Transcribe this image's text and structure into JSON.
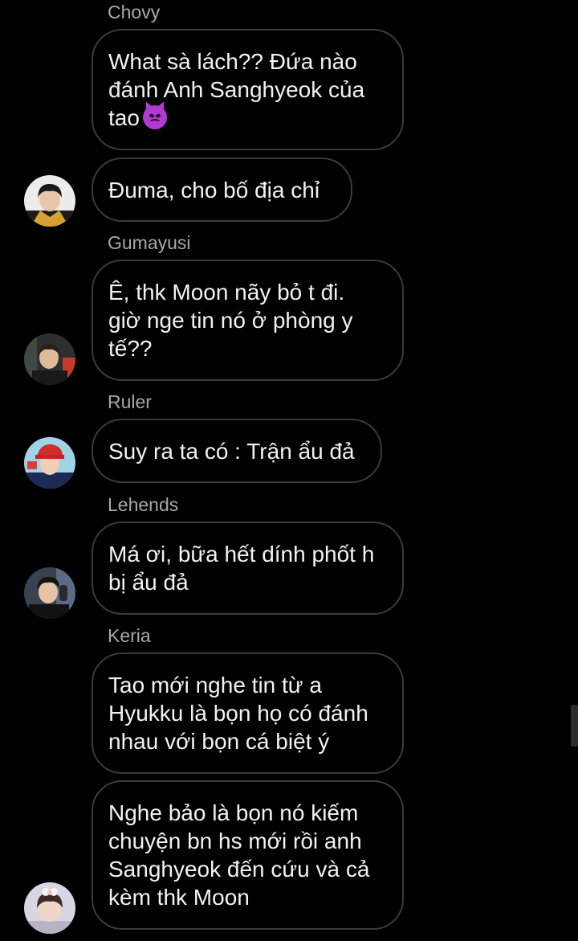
{
  "messages": [
    {
      "sender": "Chovy",
      "text": "What sà lách?? Đứa nào\nđánh Anh Sanghyeok của\ntao",
      "emoji": "smiling-imp-emoji"
    },
    {
      "sender": "",
      "text": "Đuma, cho bố địa chỉ",
      "avatar": "chovy-avatar"
    },
    {
      "sender": "Gumayusi",
      "text": "Ê, thk Moon nãy bỏ t đi.\ngiờ nge tin nó ở phòng y\ntế??",
      "avatar": "gumayusi-avatar"
    },
    {
      "sender": "Ruler",
      "text": "Suy ra ta có : Trận ẩu đả",
      "avatar": "ruler-avatar"
    },
    {
      "sender": "Lehends",
      "text": "Má ơi, bữa hết dính phốt h\nbị ẩu đả",
      "avatar": "lehends-avatar"
    },
    {
      "sender": "Keria",
      "text": "Tao mới nghe tin từ a\nHyukku là  bọn họ có đánh\nnhau với bọn cá biệt ý"
    },
    {
      "sender": "",
      "text": "Nghe bảo là bọn nó kiếm\nchuyện bn hs mới rồi anh\nSanghyeok đến cứu và cả\nkèm thk Moon",
      "avatar": "keria-avatar"
    }
  ],
  "colors": {
    "background": "#000000",
    "bubble_border": "#3b3b3b",
    "sender_name": "#a8a8a8",
    "message_text": "#f2f2f2"
  }
}
